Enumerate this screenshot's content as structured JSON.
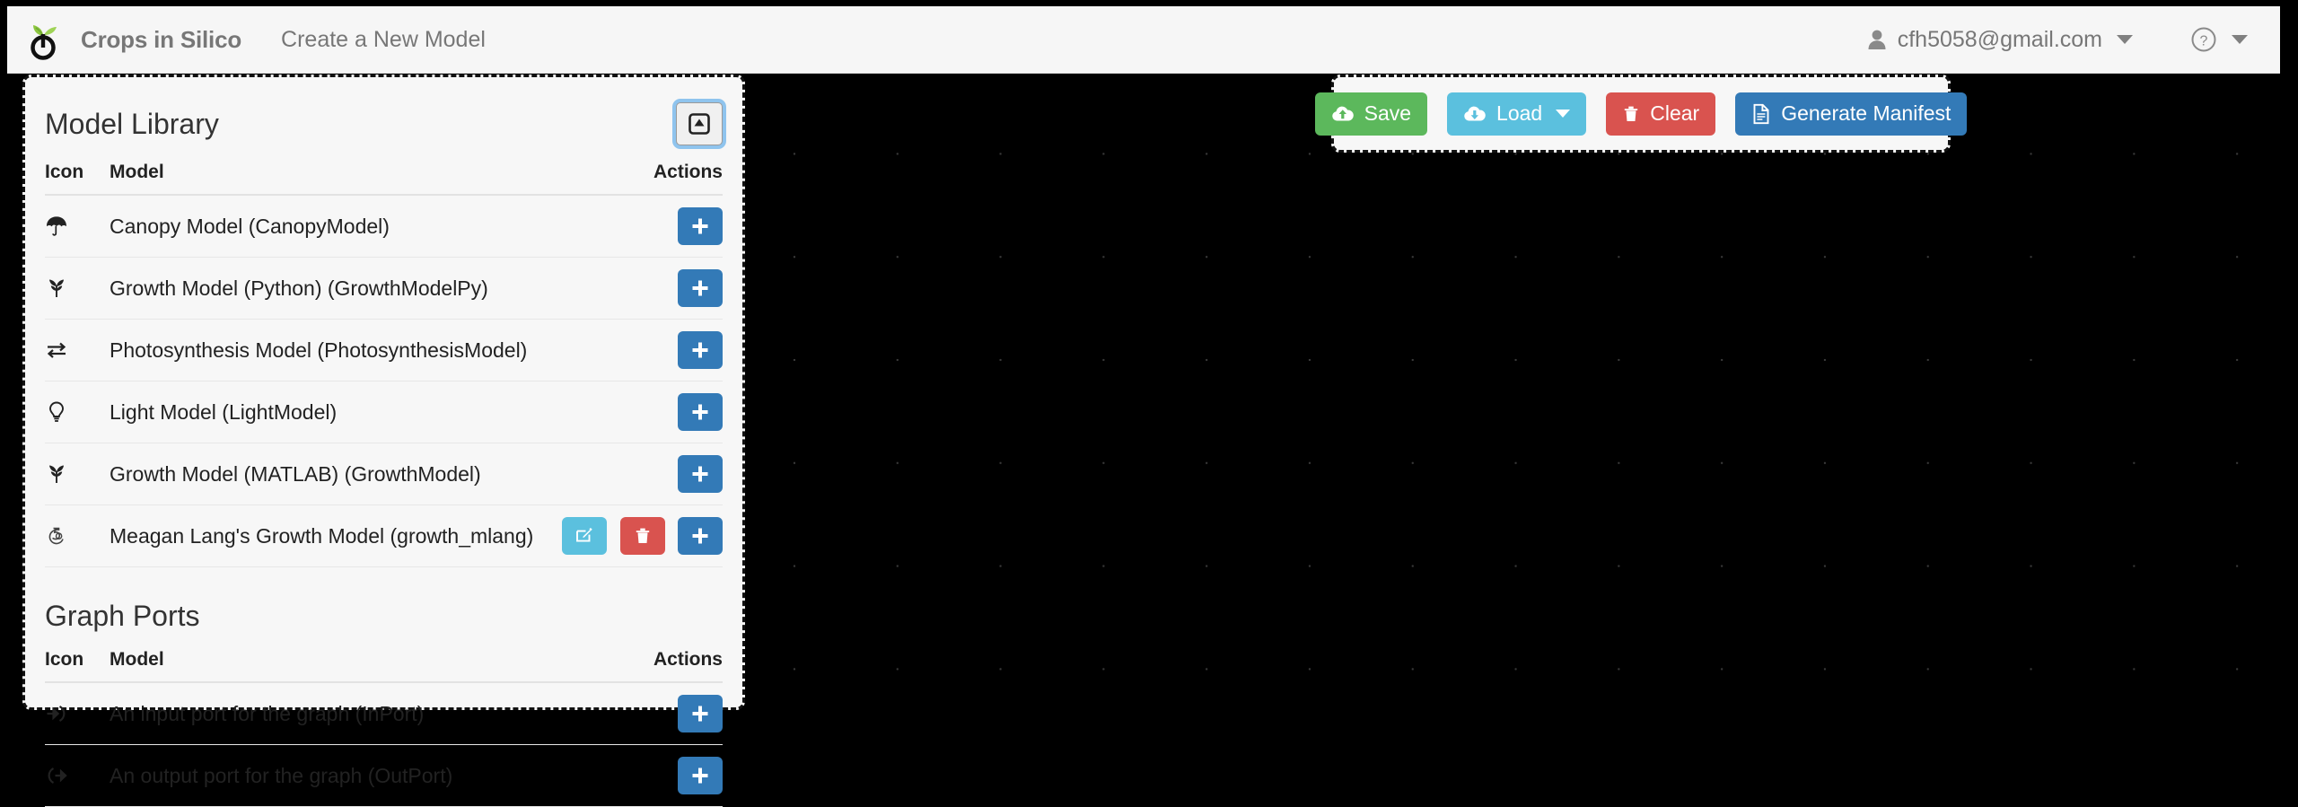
{
  "header": {
    "logo_icon": "sprout-power-logo",
    "brand": "Crops in Silico",
    "nav_link": "Create a New Model",
    "user_icon": "person-icon",
    "user_email": "cfh5058@gmail.com",
    "help_icon": "question-circle-icon"
  },
  "library": {
    "title": "Model Library",
    "collapse_icon": "collapse-up-box-icon",
    "columns": {
      "icon": "Icon",
      "model": "Model",
      "actions": "Actions"
    },
    "rows": [
      {
        "icon": "umbrella-icon",
        "name": "Canopy Model (CanopyModel)",
        "actions": [
          "add"
        ]
      },
      {
        "icon": "seedling-icon",
        "name": "Growth Model (Python) (GrowthModelPy)",
        "actions": [
          "add"
        ]
      },
      {
        "icon": "exchange-icon",
        "name": "Photosynthesis Model (PhotosynthesisModel)",
        "actions": [
          "add"
        ]
      },
      {
        "icon": "lightbulb-icon",
        "name": "Light Model (LightModel)",
        "actions": [
          "add"
        ]
      },
      {
        "icon": "seedling-icon",
        "name": "Growth Model (MATLAB) (GrowthModel)",
        "actions": [
          "add"
        ]
      },
      {
        "icon": "custom-model-icon",
        "name": "Meagan Lang's Growth Model (growth_mlang)",
        "actions": [
          "edit",
          "delete",
          "add"
        ]
      }
    ]
  },
  "ports": {
    "title": "Graph Ports",
    "columns": {
      "icon": "Icon",
      "model": "Model",
      "actions": "Actions"
    },
    "rows": [
      {
        "icon": "sign-in-icon",
        "name": "An input port for the graph (InPort)",
        "actions": [
          "add"
        ]
      },
      {
        "icon": "sign-out-icon",
        "name": "An output port for the graph (OutPort)",
        "actions": [
          "add"
        ]
      }
    ]
  },
  "toolbar": {
    "save": {
      "label": "Save",
      "icon": "cloud-upload-icon",
      "color": "#5cb85c"
    },
    "load": {
      "label": "Load",
      "icon": "cloud-download-icon",
      "color": "#5bc0de",
      "has_caret": true
    },
    "clear": {
      "label": "Clear",
      "icon": "trash-icon",
      "color": "#d9534f"
    },
    "manifest": {
      "label": "Generate Manifest",
      "icon": "file-text-icon",
      "color": "#337ab7"
    }
  },
  "canvas": {
    "background_color": "#000000",
    "grid_dot_color": "#3a3a3a"
  },
  "action_icons": {
    "add": "plus-icon",
    "edit": "pencil-square-icon",
    "delete": "trash-icon"
  }
}
